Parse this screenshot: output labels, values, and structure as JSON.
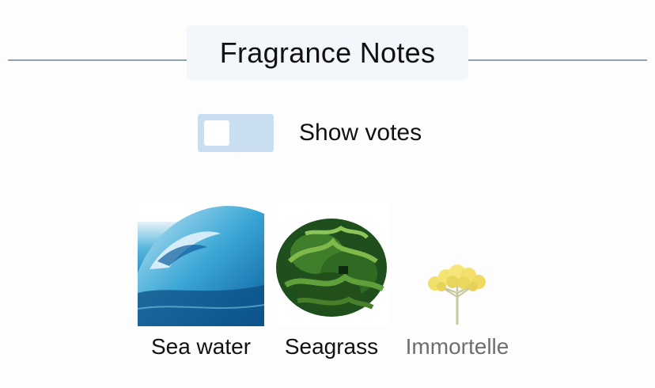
{
  "section": {
    "title": "Fragrance Notes"
  },
  "toggle": {
    "label": "Show votes",
    "checked": false
  },
  "notes": [
    {
      "label": "Sea water",
      "icon": "wave-icon",
      "color": "#111111"
    },
    {
      "label": "Seagrass",
      "icon": "seaweed-icon",
      "color": "#111111"
    },
    {
      "label": "Immortelle",
      "icon": "immortelle-flower-icon",
      "color": "#6e6e6e"
    }
  ],
  "colors": {
    "divider": "#8fa3b3",
    "title_bg": "#f3f6fa",
    "toggle_track": "#c9def0"
  }
}
